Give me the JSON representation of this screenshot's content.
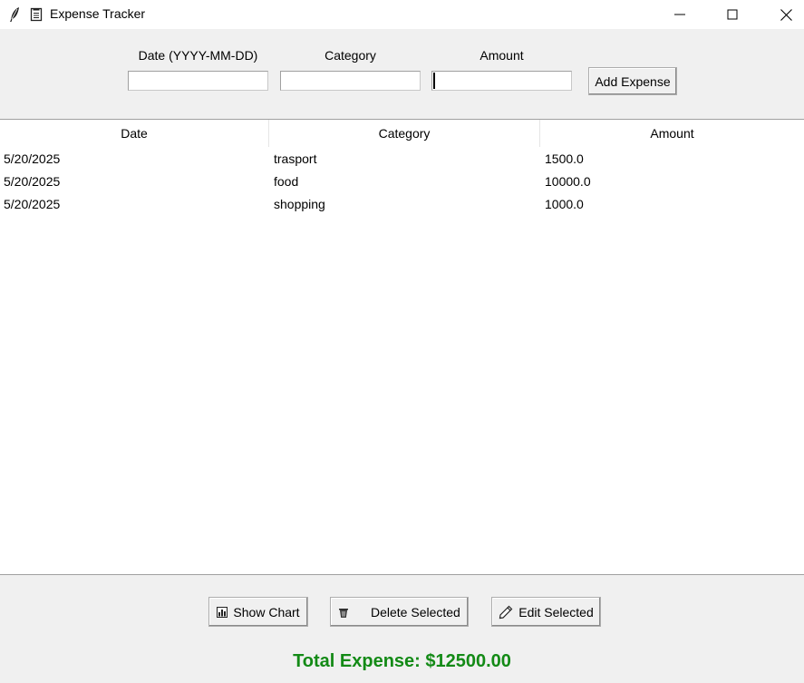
{
  "window": {
    "title": "Expense Tracker"
  },
  "form": {
    "date_label": "Date (YYYY-MM-DD)",
    "category_label": "Category",
    "amount_label": "Amount",
    "date_value": "",
    "category_value": "",
    "amount_value": "",
    "add_button": "Add Expense"
  },
  "table": {
    "columns": [
      "Date",
      "Category",
      "Amount"
    ],
    "rows": [
      [
        "5/20/2025",
        "trasport",
        "1500.0"
      ],
      [
        "5/20/2025",
        "food",
        "10000.0"
      ],
      [
        "5/20/2025",
        "shopping",
        "1000.0"
      ]
    ]
  },
  "actions": {
    "show_chart": "Show Chart",
    "delete_selected": "Delete Selected",
    "edit_selected": "Edit Selected"
  },
  "total": {
    "text": "Total Expense: $12500.00",
    "color": "#138a16"
  },
  "icons": {
    "app": "feather-icon",
    "doc": "document-icon",
    "chart": "bar-chart-icon",
    "delete": "trash-icon",
    "edit": "pencil-icon"
  }
}
